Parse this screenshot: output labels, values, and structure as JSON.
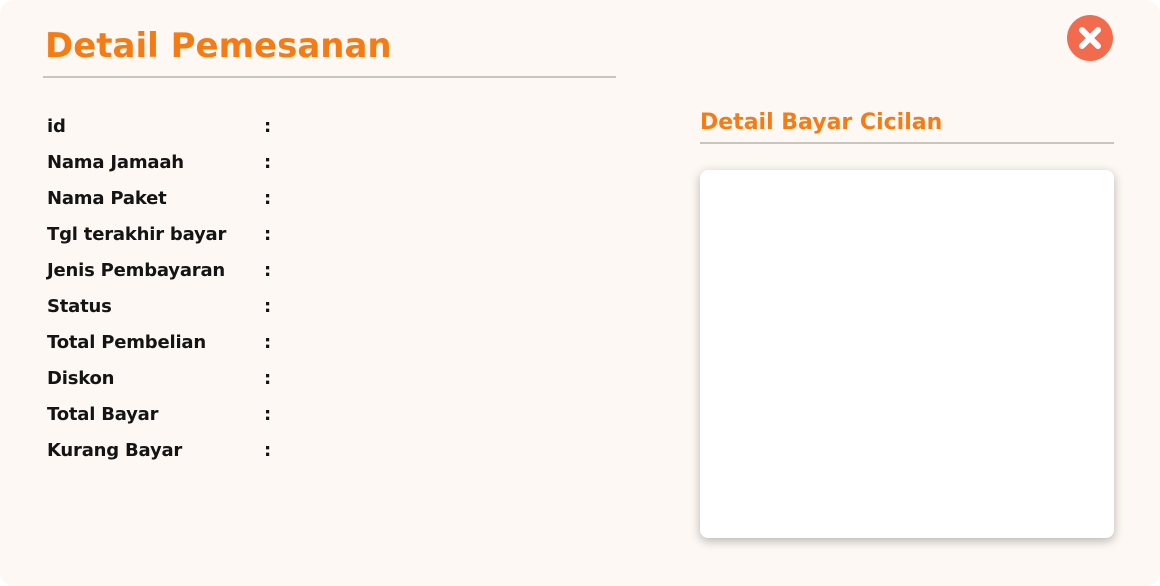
{
  "modal": {
    "title": "Detail Pemesanan",
    "close_icon": "close-circle-icon",
    "colors": {
      "accent": "#f57c14",
      "close_button": "#f26b4f",
      "background": "#fdf8f3",
      "divider": "#c8c4c0"
    }
  },
  "details": {
    "separator": ":",
    "rows": [
      {
        "label": "id",
        "value": ""
      },
      {
        "label": "Nama Jamaah",
        "value": ""
      },
      {
        "label": "Nama Paket",
        "value": ""
      },
      {
        "label": "Tgl terakhir bayar",
        "value": ""
      },
      {
        "label": "Jenis Pembayaran",
        "value": ""
      },
      {
        "label": "Status",
        "value": ""
      },
      {
        "label": "Total Pembelian",
        "value": ""
      },
      {
        "label": "Diskon",
        "value": ""
      },
      {
        "label": "Total Bayar",
        "value": ""
      },
      {
        "label": "Kurang Bayar",
        "value": ""
      }
    ]
  },
  "installments": {
    "title": "Detail Bayar Cicilan"
  }
}
